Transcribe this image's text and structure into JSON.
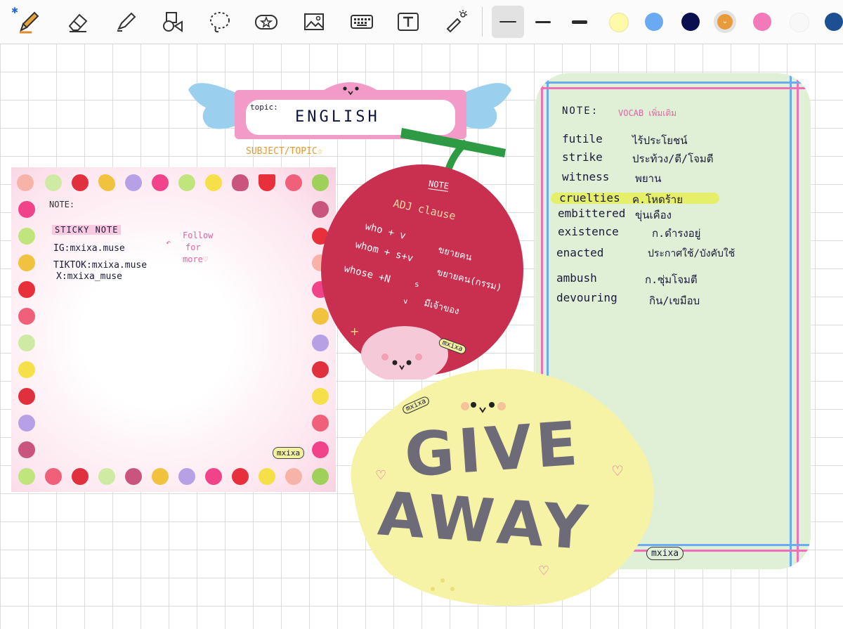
{
  "toolbar": {
    "bluetooth_icon": "bluetooth-icon",
    "tools": [
      "pen-icon",
      "eraser-icon",
      "highlighter-icon",
      "shapes-icon",
      "lasso-icon",
      "sticker-icon",
      "image-icon",
      "keyboard-icon",
      "text-box-icon",
      "laser-pointer-icon"
    ],
    "strokes": [
      "thin",
      "medium",
      "thick"
    ],
    "swatches": [
      "#fff9a8",
      "#6aaaf2",
      "#0a0f4f",
      "#e99a3a",
      "#f27ab8",
      "#f8f8f8",
      "#1d4f93"
    ]
  },
  "topic_sticker": {
    "label": "topic:",
    "subject": "ENGLISH",
    "caption": "SUBJECT/TOPIC☆"
  },
  "sticky_note": {
    "header": "NOTE:",
    "title": "STICKY NOTE",
    "lines": [
      "IG:mxixa.muse",
      "TIKTOK:mxixa.muse",
      "X:mxixa_muse"
    ],
    "follow": [
      "Follow",
      "for",
      "more♡"
    ],
    "brand": "mxixa"
  },
  "cherry": {
    "tag": "NOTE",
    "title": "ADJ clause",
    "rules": [
      {
        "pattern": "who + v",
        "meaning": "ขยายคน"
      },
      {
        "pattern": "whom + s+v",
        "meaning": "ขยายคน(กรรม)"
      },
      {
        "pattern": "whose +N",
        "meaning": "มีเจ้าของ"
      }
    ],
    "branch": [
      "s",
      "v"
    ],
    "brand": "mxixa"
  },
  "lemon": {
    "line1": "GIVE",
    "line2": "AWAY",
    "brand": "mxixa"
  },
  "vocab_card": {
    "header": "NOTE:",
    "subheader": "VOCAB เพิ่มเติม",
    "words": [
      {
        "en": "futile",
        "th": "ไร้ประโยชน์"
      },
      {
        "en": "strike",
        "th": "ประท้วง/ตี/โจมตี"
      },
      {
        "en": "witness",
        "th": "พยาน"
      },
      {
        "en": "cruelties",
        "th": "ค.โหดร้าย"
      },
      {
        "en": "embittered",
        "th": "ขุ่นเคือง"
      },
      {
        "en": "existence",
        "th": "ก.ดำรงอยู่"
      },
      {
        "en": "enacted",
        "th": "ประกาศใช้/บังคับใช้"
      },
      {
        "en": "ambush",
        "th": "ก.ซุ่มโจมตี"
      },
      {
        "en": "devouring",
        "th": "กิน/เขมือบ"
      }
    ],
    "brand": "mxixa"
  }
}
